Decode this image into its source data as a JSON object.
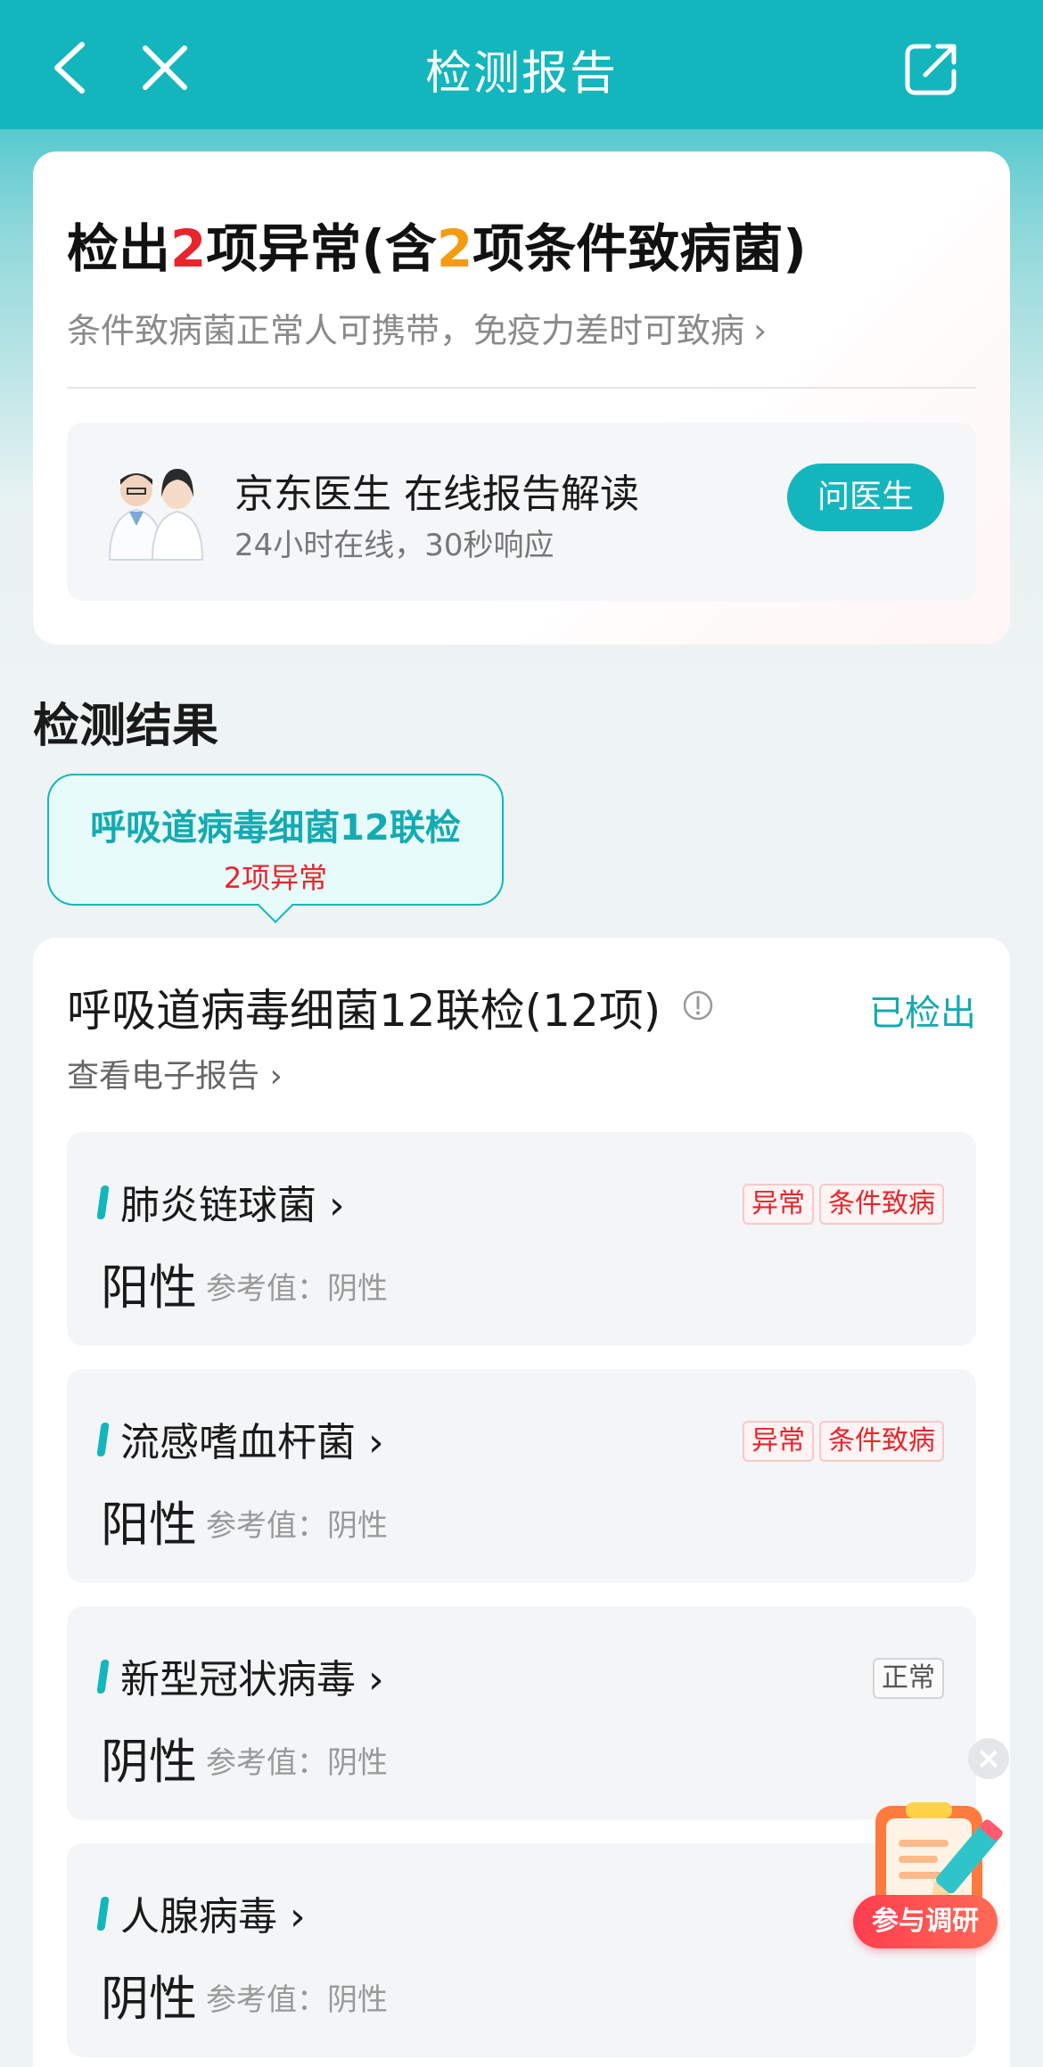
{
  "nav": {
    "title": "检测报告"
  },
  "summary": {
    "title_part1": "检出",
    "abnormal_count": "2",
    "title_part2": "项异常(含",
    "conditional_count": "2",
    "title_part3": "项条件致病菌)",
    "subtitle": "条件致病菌正常人可携带，免疫力差时可致病",
    "doctor": {
      "title": "京东医生 在线报告解读",
      "subtitle": "24小时在线，30秒响应",
      "ask_label": "问医生"
    }
  },
  "results": {
    "section_title": "检测结果",
    "tab": {
      "name": "呼吸道病毒细菌12联检",
      "abnormal": "2项异常"
    },
    "panel": {
      "title": "呼吸道病毒细菌12联检(12项)",
      "status": "已检出",
      "view_report": "查看电子报告"
    },
    "items": [
      {
        "name": "肺炎链球菌",
        "result": "阳性",
        "ref": "参考值：阴性",
        "tags": [
          "异常",
          "条件致病"
        ]
      },
      {
        "name": "流感嗜血杆菌",
        "result": "阳性",
        "ref": "参考值：阴性",
        "tags": [
          "异常",
          "条件致病"
        ]
      },
      {
        "name": "新型冠状病毒",
        "result": "阴性",
        "ref": "参考值：阴性",
        "tags": [
          "正常"
        ]
      },
      {
        "name": "人腺病毒",
        "result": "阴性",
        "ref": "参考值：阴性",
        "tags": []
      }
    ]
  },
  "survey": {
    "label": "参与调研"
  },
  "colors": {
    "accent": "#14b6bd",
    "abnormal": "#e8252b",
    "conditional": "#f39c12"
  }
}
